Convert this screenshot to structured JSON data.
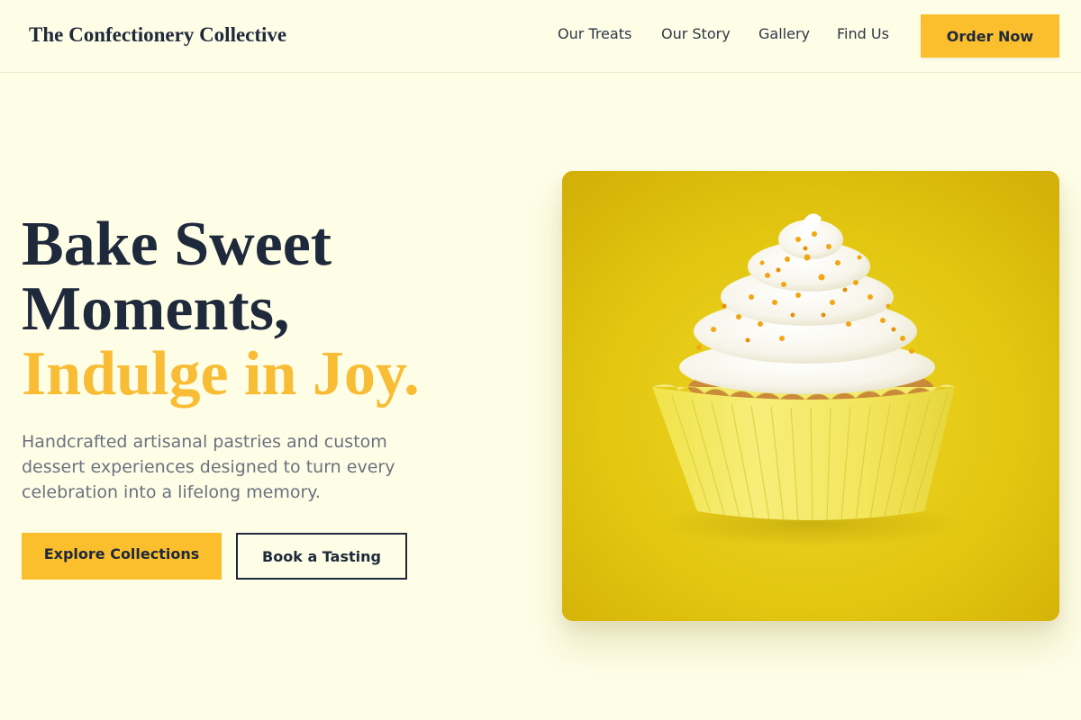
{
  "header": {
    "brand": "The Confectionery Collective",
    "nav": [
      "Our Treats",
      "Our Story",
      "Gallery",
      "Find Us"
    ],
    "cta": "Order Now"
  },
  "hero": {
    "headline_line1": "Bake Sweet",
    "headline_line2": "Moments,",
    "headline_accent": "Indulge in Joy.",
    "subtext": "Handcrafted artisanal pastries and custom dessert experiences designed to turn every celebration into a lifelong memory.",
    "primary_cta": "Explore Collections",
    "secondary_cta": "Book a Tasting",
    "image": {
      "subject": "cupcake-with-white-frosting-and-orange-sprinkles",
      "background_color": "#e3c60f"
    }
  },
  "colors": {
    "page_background": "#fefde6",
    "accent": "#fbbf2d",
    "headline": "#1e293b",
    "headline_accent": "#f8bd35",
    "body_text": "#6b7280"
  }
}
